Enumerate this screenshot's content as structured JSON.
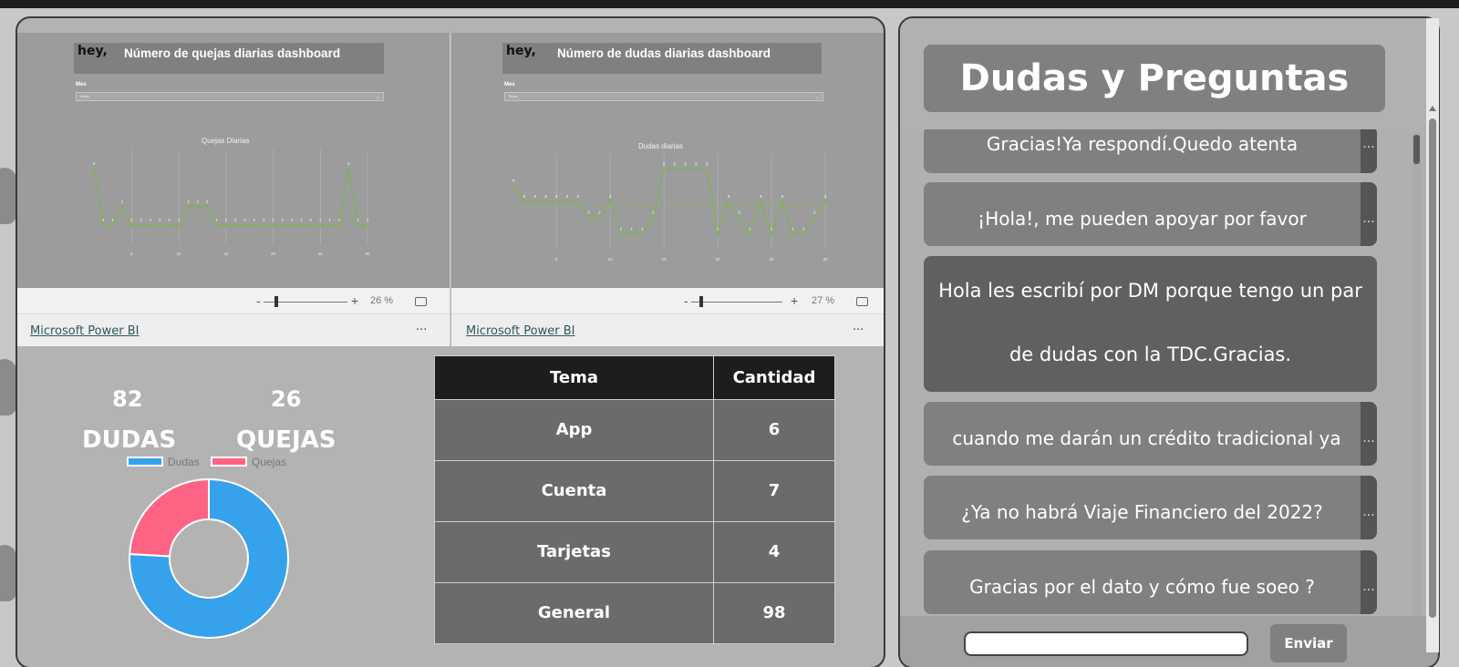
{
  "embeds": [
    {
      "report_brand": "hey,",
      "report_title": "Número de quejas diarias dashboard",
      "filter_label": "Mes",
      "filter_value": "Todas",
      "chart_title": "Quejas Diarias",
      "zoom_minus": "-",
      "zoom_plus": "+",
      "zoom_pct": "26 %",
      "link_text": "Microsoft Power BI",
      "more": "..."
    },
    {
      "report_brand": "hey,",
      "report_title": "Número de dudas diarias dashboard",
      "filter_label": "Mes",
      "filter_value": "Todas",
      "chart_title": "Dudas diarias",
      "zoom_minus": "-",
      "zoom_plus": "+",
      "zoom_pct": "27 %",
      "link_text": "Microsoft Power BI",
      "more": "..."
    }
  ],
  "chart_data": [
    {
      "type": "line",
      "title": "Quejas Diarias",
      "x": [
        1,
        2,
        3,
        4,
        5,
        6,
        7,
        8,
        9,
        10,
        11,
        12,
        13,
        14,
        15,
        16,
        17,
        18,
        19,
        20,
        21,
        22,
        23,
        24,
        25,
        26,
        27,
        28,
        29,
        30
      ],
      "series": [
        {
          "values": [
            4,
            1,
            1,
            2,
            1,
            1,
            1,
            1,
            1,
            1,
            2,
            2,
            2,
            1,
            1,
            1,
            1,
            1,
            1,
            1,
            1,
            1,
            1,
            1,
            1,
            1,
            1,
            4,
            1,
            1
          ]
        }
      ],
      "xticks": [
        5,
        10,
        15,
        20,
        25,
        30
      ],
      "ylim": [
        0,
        5
      ],
      "color": "#7ab648"
    },
    {
      "type": "line",
      "title": "Dudas diarias",
      "x": [
        1,
        2,
        3,
        4,
        5,
        6,
        7,
        8,
        9,
        10,
        11,
        12,
        13,
        14,
        15,
        16,
        17,
        18,
        19,
        20,
        21,
        22,
        23,
        24,
        25,
        26,
        27,
        28,
        29,
        30
      ],
      "series": [
        {
          "values": [
            4,
            3,
            3,
            3,
            3,
            3,
            3,
            2,
            2,
            3,
            1,
            1,
            1,
            2,
            5,
            5,
            5,
            5,
            5,
            1,
            3,
            2,
            1,
            3,
            1,
            3,
            1,
            1,
            2,
            3
          ]
        }
      ],
      "xticks": [
        5,
        10,
        15,
        20,
        25,
        30
      ],
      "ylim": [
        0,
        6
      ],
      "color": "#7ab648"
    }
  ],
  "summary": {
    "dudas_count": "82",
    "dudas_label": "DUDAS",
    "quejas_count": "26",
    "quejas_label": "QUEJAS",
    "legend": [
      {
        "label": "Dudas",
        "color": "#36a2eb"
      },
      {
        "label": "Quejas",
        "color": "#ff6384"
      }
    ],
    "donut": {
      "type": "pie",
      "values": [
        82,
        26
      ],
      "labels": [
        "Dudas",
        "Quejas"
      ],
      "colors": [
        "#36a2eb",
        "#ff6384"
      ]
    }
  },
  "topics": {
    "headers": [
      "Tema",
      "Cantidad"
    ],
    "rows": [
      [
        "App",
        "6"
      ],
      [
        "Cuenta",
        "7"
      ],
      [
        "Tarjetas",
        "4"
      ],
      [
        "General",
        "98"
      ]
    ]
  },
  "questions": {
    "title": "Dudas y Preguntas",
    "messages": [
      {
        "text": "Gracias!Ya respondí.Quedo atenta",
        "menu": "..."
      },
      {
        "text": "¡Hola!, me pueden apoyar por favor",
        "menu": "..."
      },
      {
        "text_line1": "Hola les escribí por DM porque tengo un par",
        "text_line2": "de dudas con la TDC.Gracias."
      },
      {
        "text": "cuando me darán un crédito tradicional ya",
        "menu": "..."
      },
      {
        "text": "¿Ya no habrá Viaje Financiero del 2022?",
        "menu": "..."
      },
      {
        "text": "Gracias por el dato y cómo fue soeo ?",
        "menu": "..."
      }
    ],
    "input_placeholder": "",
    "send_label": "Enviar"
  }
}
